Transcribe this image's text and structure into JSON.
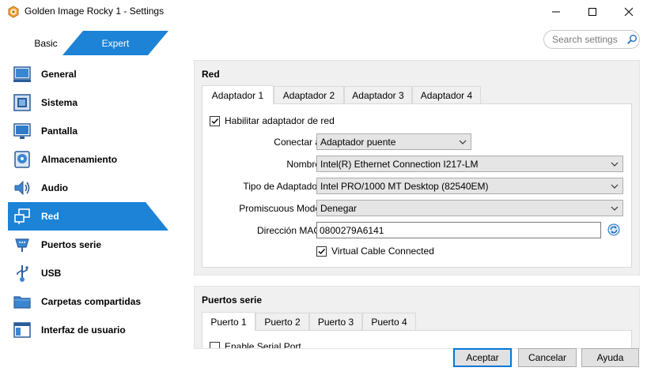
{
  "window": {
    "title": "Golden Image Rocky 1 - Settings"
  },
  "mode": {
    "basic_label": "Basic",
    "expert_label": "Expert",
    "active": "Expert"
  },
  "search": {
    "placeholder": "Search settings"
  },
  "sidebar": {
    "items": [
      {
        "label": "General",
        "icon": "general-icon",
        "active": false
      },
      {
        "label": "Sistema",
        "icon": "system-icon",
        "active": false
      },
      {
        "label": "Pantalla",
        "icon": "display-icon",
        "active": false
      },
      {
        "label": "Almacenamiento",
        "icon": "storage-icon",
        "active": false
      },
      {
        "label": "Audio",
        "icon": "audio-icon",
        "active": false
      },
      {
        "label": "Red",
        "icon": "network-icon",
        "active": true
      },
      {
        "label": "Puertos serie",
        "icon": "serial-ports-icon",
        "active": false
      },
      {
        "label": "USB",
        "icon": "usb-icon",
        "active": false
      },
      {
        "label": "Carpetas compartidas",
        "icon": "shared-folders-icon",
        "active": false
      },
      {
        "label": "Interfaz de usuario",
        "icon": "user-interface-icon",
        "active": false
      }
    ]
  },
  "network": {
    "title": "Red",
    "tabs": [
      "Adaptador 1",
      "Adaptador 2",
      "Adaptador 3",
      "Adaptador 4"
    ],
    "active_tab": "Adaptador 1",
    "enable_label": "Habilitar adaptador de red",
    "enable_checked": true,
    "attached_label": "Conectar a",
    "attached_value": "Adaptador puente",
    "name_label": "Nombre",
    "name_value": "Intel(R) Ethernet Connection I217-LM",
    "adapter_type_label": "Tipo de Adaptador",
    "adapter_type_value": "Intel PRO/1000 MT Desktop (82540EM)",
    "promiscuous_label": "Promiscuous Mode",
    "promiscuous_value": "Denegar",
    "mac_label": "Dirección MAC",
    "mac_value": "0800279A6141",
    "cable_label": "Virtual Cable Connected",
    "cable_checked": true
  },
  "serial": {
    "title": "Puertos serie",
    "tabs": [
      "Puerto 1",
      "Puerto 2",
      "Puerto 3",
      "Puerto 4"
    ],
    "active_tab": "Puerto 1",
    "enable_label": "Enable Serial Port"
  },
  "buttons": {
    "ok": "Aceptar",
    "cancel": "Cancelar",
    "help": "Ayuda"
  },
  "colors": {
    "accent": "#0078d7",
    "active_blue": "#1c83d6"
  }
}
